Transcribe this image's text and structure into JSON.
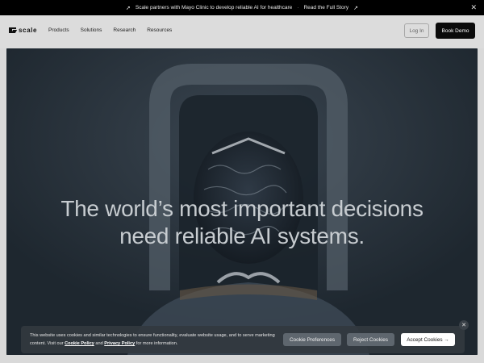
{
  "announcement": {
    "text": "Scale partners with Mayo Clinic to develop reliable AI for healthcare",
    "separator": "·",
    "cta": "Read the Full Story",
    "close_label": "✕"
  },
  "nav": {
    "logo": "scale",
    "links": [
      "Products",
      "Solutions",
      "Research",
      "Resources"
    ],
    "login_label": "Log In",
    "demo_label": "Book Demo"
  },
  "hero": {
    "headline_line1": "The world’s most important decisions",
    "headline_line2": "need reliable AI systems."
  },
  "cookie": {
    "text_before": "This website uses cookies and similar technologies to ensure functionality, evaluate website usage, and to serve marketing content. Visit our ",
    "cookie_policy": "Cookie Policy",
    "and": " and ",
    "privacy_policy": "Privacy Policy",
    "text_after": " for more information.",
    "preferences_label": "Cookie Preferences",
    "reject_label": "Reject Cookies",
    "accept_label": "Accept Cookies →",
    "close_label": "✕"
  },
  "colors": {
    "announce_bg": "#000000",
    "nav_bg": "#dcdcdc",
    "hero_bg": "#232d35",
    "cookie_bg": "#32383f",
    "demo_button": "#0b0b0b"
  }
}
